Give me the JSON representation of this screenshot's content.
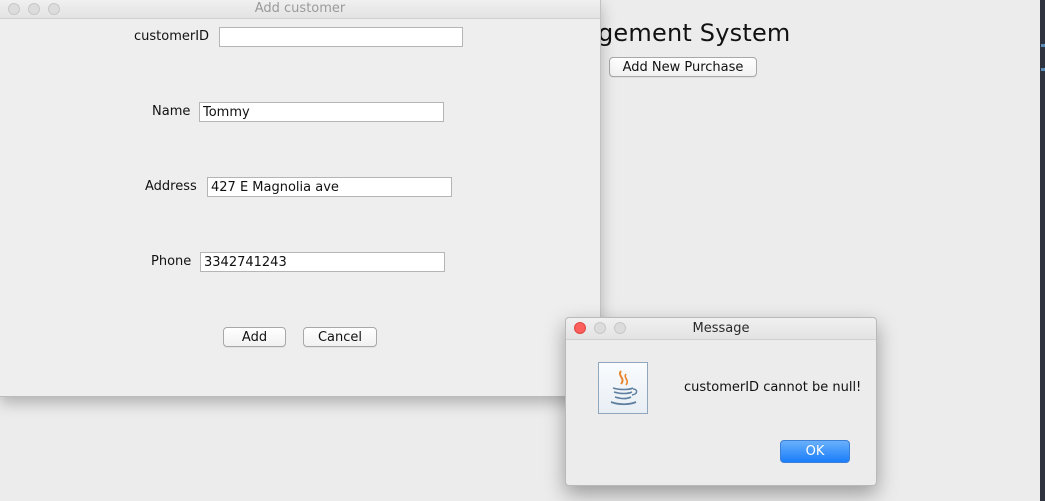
{
  "main_window": {
    "title_fragment": "gement System",
    "add_purchase_label": "Add New Purchase"
  },
  "add_customer_dialog": {
    "title": "Add customer",
    "fields": {
      "customer_id": {
        "label": "customerID",
        "value": ""
      },
      "name": {
        "label": "Name",
        "value": "Tommy"
      },
      "address": {
        "label": "Address",
        "value": "427 E Magnolia ave"
      },
      "phone": {
        "label": "Phone",
        "value": "3342741243"
      }
    },
    "add_label": "Add",
    "cancel_label": "Cancel"
  },
  "message_dialog": {
    "title": "Message",
    "icon": "java-icon",
    "text": "customerID cannot be null!",
    "ok_label": "OK"
  },
  "colors": {
    "window_bg": "#ececec",
    "ok_button": "#1a7dfa",
    "close_light": "#fc605c"
  }
}
